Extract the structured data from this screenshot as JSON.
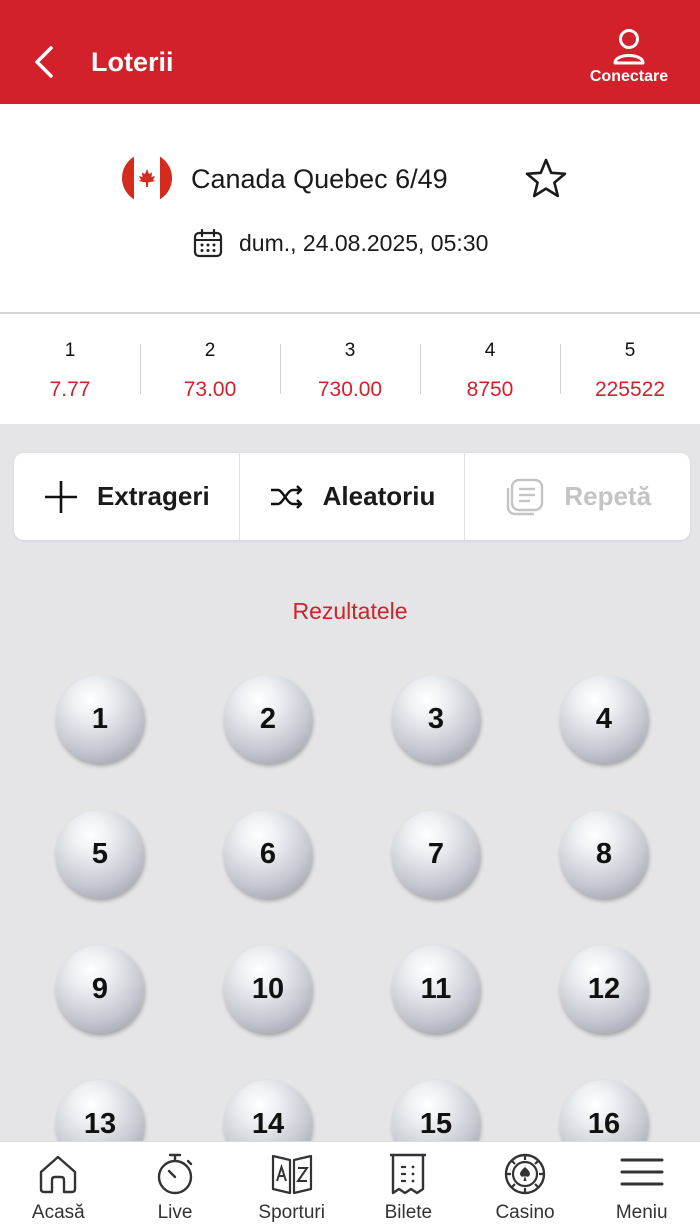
{
  "header": {
    "title": "Loterii",
    "login_label": "Conectare"
  },
  "lottery": {
    "name": "Canada Quebec 6/49",
    "date": "dum., 24.08.2025, 05:30"
  },
  "odds": [
    {
      "hits": "1",
      "value": "7.77"
    },
    {
      "hits": "2",
      "value": "73.00"
    },
    {
      "hits": "3",
      "value": "730.00"
    },
    {
      "hits": "4",
      "value": "8750"
    },
    {
      "hits": "5",
      "value": "225522"
    }
  ],
  "actions": {
    "draws_label": "Extrageri",
    "random_label": "Aleatoriu",
    "repeat_label": "Repetă"
  },
  "results_title": "Rezultatele",
  "balls": [
    "1",
    "2",
    "3",
    "4",
    "5",
    "6",
    "7",
    "8",
    "9",
    "10",
    "11",
    "12",
    "13",
    "14",
    "15",
    "16"
  ],
  "nav": [
    {
      "label": "Acasă",
      "icon": "home-icon"
    },
    {
      "label": "Live",
      "icon": "stopwatch-icon"
    },
    {
      "label": "Sporturi",
      "icon": "az-icon"
    },
    {
      "label": "Bilete",
      "icon": "ticket-icon"
    },
    {
      "label": "Casino",
      "icon": "casino-chip-icon"
    },
    {
      "label": "Meniu",
      "icon": "hamburger-icon"
    }
  ],
  "colors": {
    "brand_red": "#d3212b",
    "background": "#e5e5e8",
    "disabled": "#c4c4c4"
  }
}
